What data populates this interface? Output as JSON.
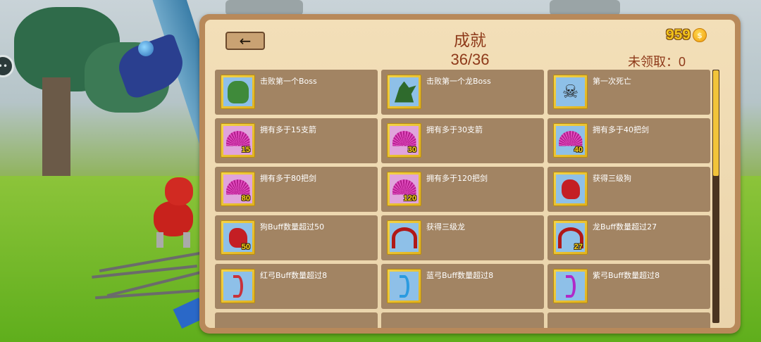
{
  "header": {
    "title": "成就",
    "progress": "36/36",
    "back_icon": "←",
    "coins": "959",
    "coin_icon": "coin-icon",
    "unclaimed_label": "未领取：",
    "unclaimed_value": "0"
  },
  "achievements": [
    {
      "label": "击败第一个Boss",
      "icon": "boss-icon",
      "badge": ""
    },
    {
      "label": "击败第一个龙Boss",
      "icon": "dragon-icon",
      "badge": ""
    },
    {
      "label": "第一次死亡",
      "icon": "skull-icon",
      "badge": ""
    },
    {
      "label": "拥有多于15支箭",
      "icon": "arrow-fan-icon",
      "badge": "15"
    },
    {
      "label": "拥有多于30支箭",
      "icon": "arrow-fan-icon",
      "badge": "30"
    },
    {
      "label": "拥有多于40把剑",
      "icon": "sword-fan-icon",
      "badge": "40"
    },
    {
      "label": "拥有多于80把剑",
      "icon": "sword-fan-icon",
      "badge": "80"
    },
    {
      "label": "拥有多于120把剑",
      "icon": "sword-fan-icon",
      "badge": "120"
    },
    {
      "label": "获得三级狗",
      "icon": "red-dog-icon",
      "badge": ""
    },
    {
      "label": "狗Buff数量超过50",
      "icon": "red-dog-icon",
      "badge": "50"
    },
    {
      "label": "获得三级龙",
      "icon": "red-dragon-icon",
      "badge": ""
    },
    {
      "label": "龙Buff数量超过27",
      "icon": "red-dragon-icon",
      "badge": "27"
    },
    {
      "label": "红弓Buff数量超过8",
      "icon": "red-bow-icon",
      "badge": ""
    },
    {
      "label": "蓝弓Buff数量超过8",
      "icon": "blue-bow-icon",
      "badge": ""
    },
    {
      "label": "紫弓Buff数量超过8",
      "icon": "purple-bow-icon",
      "badge": ""
    }
  ],
  "colors": {
    "panel": "#b8895a",
    "parchment": "#f3dfb8",
    "card": "#a28463",
    "title": "#8e3a1a",
    "coin": "#f2c21c",
    "frame": "#f4d44a",
    "scroll_thumb": "#f2c43a"
  }
}
